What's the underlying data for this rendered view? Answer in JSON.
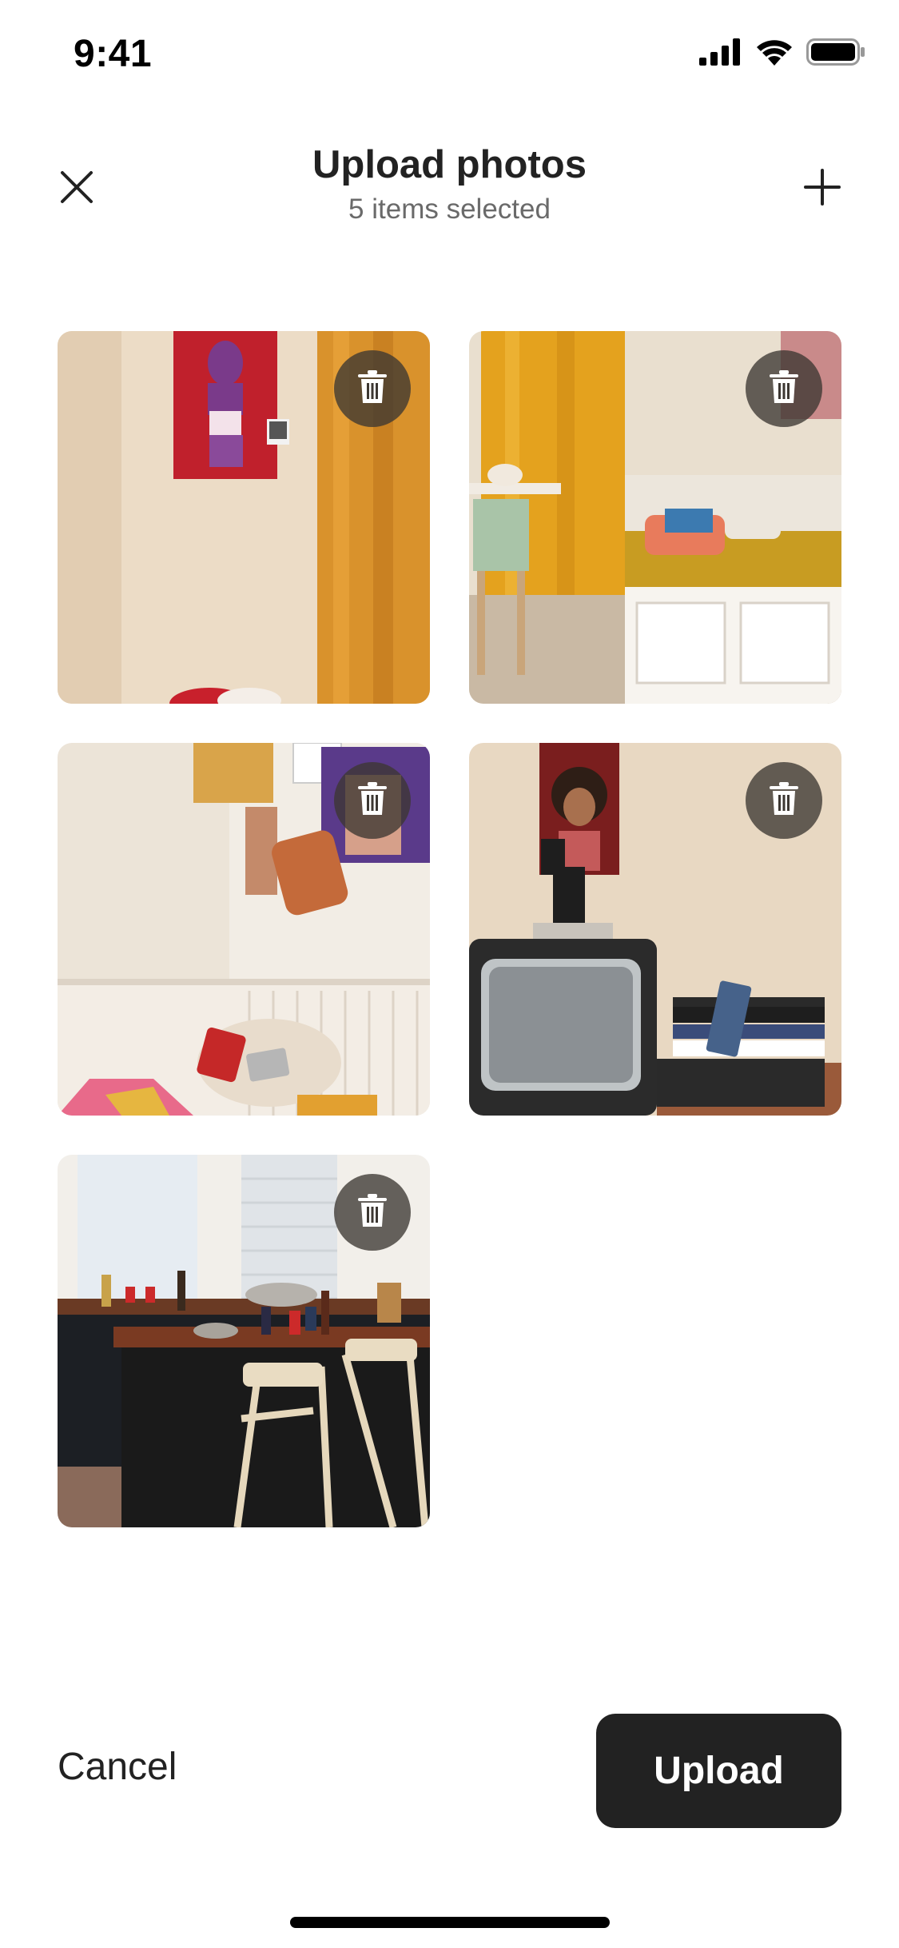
{
  "status_bar": {
    "time": "9:41",
    "icons": [
      "cellular-signal-icon",
      "wifi-icon",
      "battery-icon"
    ]
  },
  "header": {
    "title": "Upload photos",
    "subtitle": "5 items selected",
    "close_icon": "close-icon",
    "add_icon": "plus-icon"
  },
  "photos": [
    {
      "scene": "bedroom corner with poster and orange curtain",
      "delete_icon": "trash-icon"
    },
    {
      "scene": "bedroom with yellow curtain and daybed",
      "delete_icon": "trash-icon"
    },
    {
      "scene": "corner with posters and pillows",
      "delete_icon": "trash-icon"
    },
    {
      "scene": "vintage TV with camcorder and VHS tapes",
      "delete_icon": "trash-icon"
    },
    {
      "scene": "kitchen counter with bottles and chairs",
      "delete_icon": "trash-icon"
    }
  ],
  "footer": {
    "cancel_label": "Cancel",
    "upload_label": "Upload"
  },
  "colors": {
    "primary_button": "#222222",
    "text_primary": "#222222",
    "text_secondary": "#6a6a6a",
    "delete_button_bg": "#3c3732"
  }
}
